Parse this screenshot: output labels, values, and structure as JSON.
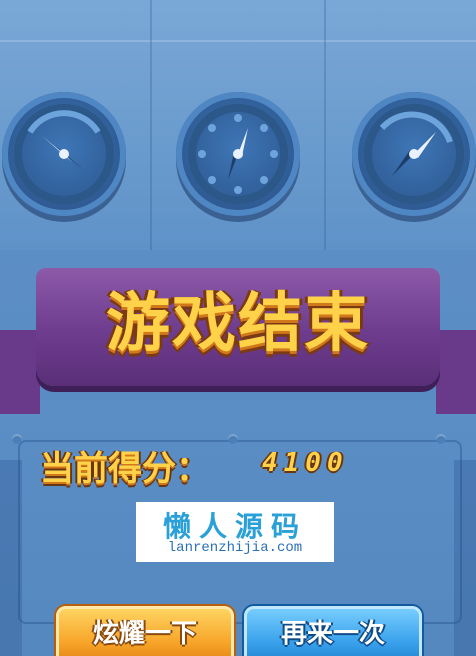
{
  "gameover": {
    "title": "游戏结束",
    "score_label": "当前得分：",
    "score_value": "4100"
  },
  "watermark": {
    "name": "懒人源码",
    "url": "lanrenzhijia.com"
  },
  "buttons": {
    "show_off": "炫耀一下",
    "play_again": "再来一次"
  },
  "gauges": [
    {
      "icon": "compass-gauge-icon"
    },
    {
      "icon": "compass-gauge-icon"
    },
    {
      "icon": "compass-gauge-icon"
    }
  ],
  "colors": {
    "background": "#5d8fc6",
    "ribbon": "#6e3c8e",
    "title_gold": "#ffd24a",
    "button_orange": "#f7a62a",
    "button_blue": "#3aa2ec",
    "watermark_cyan": "#2aa0d8"
  }
}
